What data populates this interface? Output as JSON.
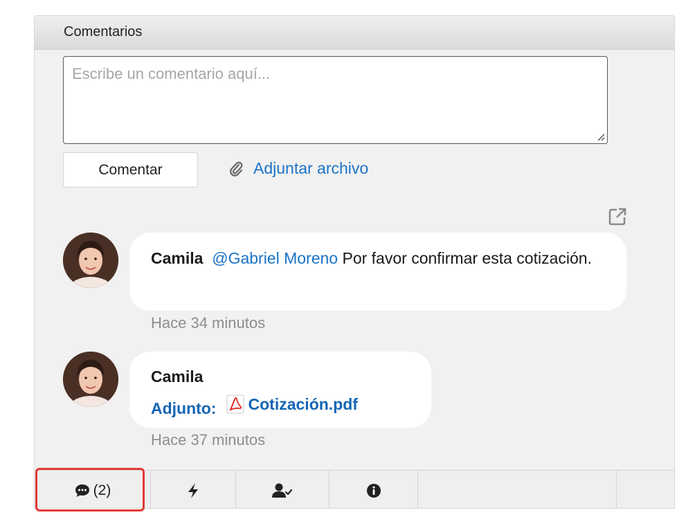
{
  "panel": {
    "title": "Comentarios"
  },
  "composer": {
    "placeholder": "Escribe un comentario aquí...",
    "value": "",
    "submit_label": "Comentar",
    "attach_label": "Adjuntar archivo"
  },
  "comments": [
    {
      "author": "Camila",
      "mention": "@Gabriel Moreno",
      "text": " Por favor confirmar esta cotización.",
      "time": "Hace 34 minutos",
      "avatar_icon": "avatar-photo"
    },
    {
      "author": "Camila",
      "attachment_label": "Adjunto:",
      "attachment_file": "Cotización.pdf",
      "attachment_icon": "pdf-icon",
      "time": "Hace 37 minutos",
      "avatar_icon": "avatar-photo"
    }
  ],
  "tabs": [
    {
      "icon": "comment-icon",
      "count": "(2)",
      "active": true
    },
    {
      "icon": "bolt-icon"
    },
    {
      "icon": "user-check-icon"
    },
    {
      "icon": "info-icon"
    }
  ],
  "colors": {
    "link": "#1a73c8",
    "attachment": "#1565b5",
    "muted": "#8d8d8d",
    "highlight": "#e53935",
    "panel_bg": "#f1f1f1"
  }
}
